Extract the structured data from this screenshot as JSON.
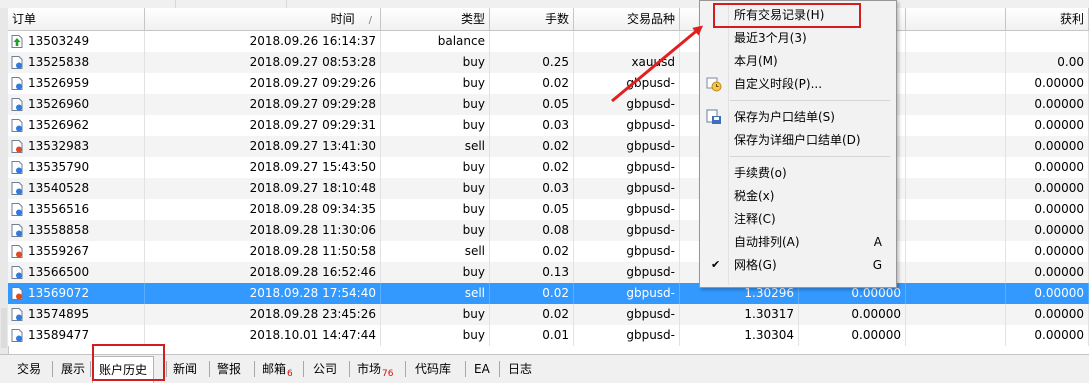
{
  "columns": [
    "订单",
    "时间",
    "类型",
    "手数",
    "交易品种",
    "",
    "",
    "",
    "获利"
  ],
  "sort_indicator": "/",
  "rows": [
    {
      "order": "13503249",
      "time": "2018.09.26 16:14:37",
      "type": "balance",
      "lots": "",
      "symbol": "",
      "price": "",
      "sl": "",
      "tp": "",
      "profit": "",
      "icon": "balance"
    },
    {
      "order": "13525838",
      "time": "2018.09.27 08:53:28",
      "type": "buy",
      "lots": "0.25",
      "symbol": "xauusd",
      "price": "",
      "sl": "",
      "tp": "",
      "profit": "0.00",
      "icon": "buy"
    },
    {
      "order": "13526959",
      "time": "2018.09.27 09:29:26",
      "type": "buy",
      "lots": "0.02",
      "symbol": "gbpusd-",
      "price": "",
      "sl": "",
      "tp": "",
      "profit": "0.00000",
      "icon": "buy"
    },
    {
      "order": "13526960",
      "time": "2018.09.27 09:29:28",
      "type": "buy",
      "lots": "0.05",
      "symbol": "gbpusd-",
      "price": "",
      "sl": "",
      "tp": "",
      "profit": "0.00000",
      "icon": "buy"
    },
    {
      "order": "13526962",
      "time": "2018.09.27 09:29:31",
      "type": "buy",
      "lots": "0.03",
      "symbol": "gbpusd-",
      "price": "",
      "sl": "",
      "tp": "",
      "profit": "0.00000",
      "icon": "buy"
    },
    {
      "order": "13532983",
      "time": "2018.09.27 13:41:30",
      "type": "sell",
      "lots": "0.02",
      "symbol": "gbpusd-",
      "price": "",
      "sl": "",
      "tp": "",
      "profit": "0.00000",
      "icon": "sell"
    },
    {
      "order": "13535790",
      "time": "2018.09.27 15:43:50",
      "type": "buy",
      "lots": "0.02",
      "symbol": "gbpusd-",
      "price": "",
      "sl": "",
      "tp": "",
      "profit": "0.00000",
      "icon": "buy"
    },
    {
      "order": "13540528",
      "time": "2018.09.27 18:10:48",
      "type": "buy",
      "lots": "0.03",
      "symbol": "gbpusd-",
      "price": "",
      "sl": "",
      "tp": "",
      "profit": "0.00000",
      "icon": "buy"
    },
    {
      "order": "13556516",
      "time": "2018.09.28 09:34:35",
      "type": "buy",
      "lots": "0.05",
      "symbol": "gbpusd-",
      "price": "",
      "sl": "",
      "tp": "",
      "profit": "0.00000",
      "icon": "buy"
    },
    {
      "order": "13558858",
      "time": "2018.09.28 11:30:06",
      "type": "buy",
      "lots": "0.08",
      "symbol": "gbpusd-",
      "price": "",
      "sl": "",
      "tp": "",
      "profit": "0.00000",
      "icon": "buy"
    },
    {
      "order": "13559267",
      "time": "2018.09.28 11:50:58",
      "type": "sell",
      "lots": "0.02",
      "symbol": "gbpusd-",
      "price": "",
      "sl": "",
      "tp": "",
      "profit": "0.00000",
      "icon": "sell"
    },
    {
      "order": "13566500",
      "time": "2018.09.28 16:52:46",
      "type": "buy",
      "lots": "0.13",
      "symbol": "gbpusd-",
      "price": "",
      "sl": "",
      "tp": "",
      "profit": "0.00000",
      "icon": "buy"
    },
    {
      "order": "13569072",
      "time": "2018.09.28 17:54:40",
      "type": "sell",
      "lots": "0.02",
      "symbol": "gbpusd-",
      "price": "1.30296",
      "sl": "0.00000",
      "tp": "",
      "profit": "0.00000",
      "icon": "sell",
      "selected": true
    },
    {
      "order": "13574895",
      "time": "2018.09.28 23:45:26",
      "type": "buy",
      "lots": "0.02",
      "symbol": "gbpusd-",
      "price": "1.30317",
      "sl": "0.00000",
      "tp": "",
      "profit": "0.00000",
      "icon": "buy"
    },
    {
      "order": "13589477",
      "time": "2018.10.01 14:47:44",
      "type": "buy",
      "lots": "0.01",
      "symbol": "gbpusd-",
      "price": "1.30304",
      "sl": "0.00000",
      "tp": "",
      "profit": "0.00000",
      "icon": "buy"
    }
  ],
  "tabs": [
    {
      "label": "交易",
      "badge": ""
    },
    {
      "label": "展示",
      "badge": ""
    },
    {
      "label": "账户历史",
      "badge": "",
      "active": true
    },
    {
      "label": "新闻",
      "badge": ""
    },
    {
      "label": "警报",
      "badge": ""
    },
    {
      "label": "邮箱",
      "badge": "6"
    },
    {
      "label": "公司",
      "badge": ""
    },
    {
      "label": "市场",
      "badge": "76"
    },
    {
      "label": "代码库",
      "badge": ""
    },
    {
      "label": "EA",
      "badge": ""
    },
    {
      "label": "日志",
      "badge": ""
    }
  ],
  "context_menu": {
    "items": [
      {
        "label": "所有交易记录(H)",
        "highlighted": true
      },
      {
        "label": "最近3个月(3)"
      },
      {
        "label": "本月(M)"
      },
      {
        "label": "自定义时段(P)...",
        "icon": "calendar-clock-icon"
      },
      {
        "separator": true
      },
      {
        "label": "保存为户口结单(S)",
        "icon": "save-report-icon"
      },
      {
        "label": "保存为详细户口结单(D)"
      },
      {
        "separator": true
      },
      {
        "label": "手续费(o)"
      },
      {
        "label": "税金(x)"
      },
      {
        "label": "注释(C)"
      },
      {
        "label": "自动排列(A)",
        "shortcut": "A"
      },
      {
        "label": "网格(G)",
        "shortcut": "G",
        "checked": true
      }
    ]
  },
  "colors": {
    "selection": "#3399ff",
    "highlight_box": "#d21e1e",
    "arrow": "#e02020",
    "badge": "#d01010"
  }
}
